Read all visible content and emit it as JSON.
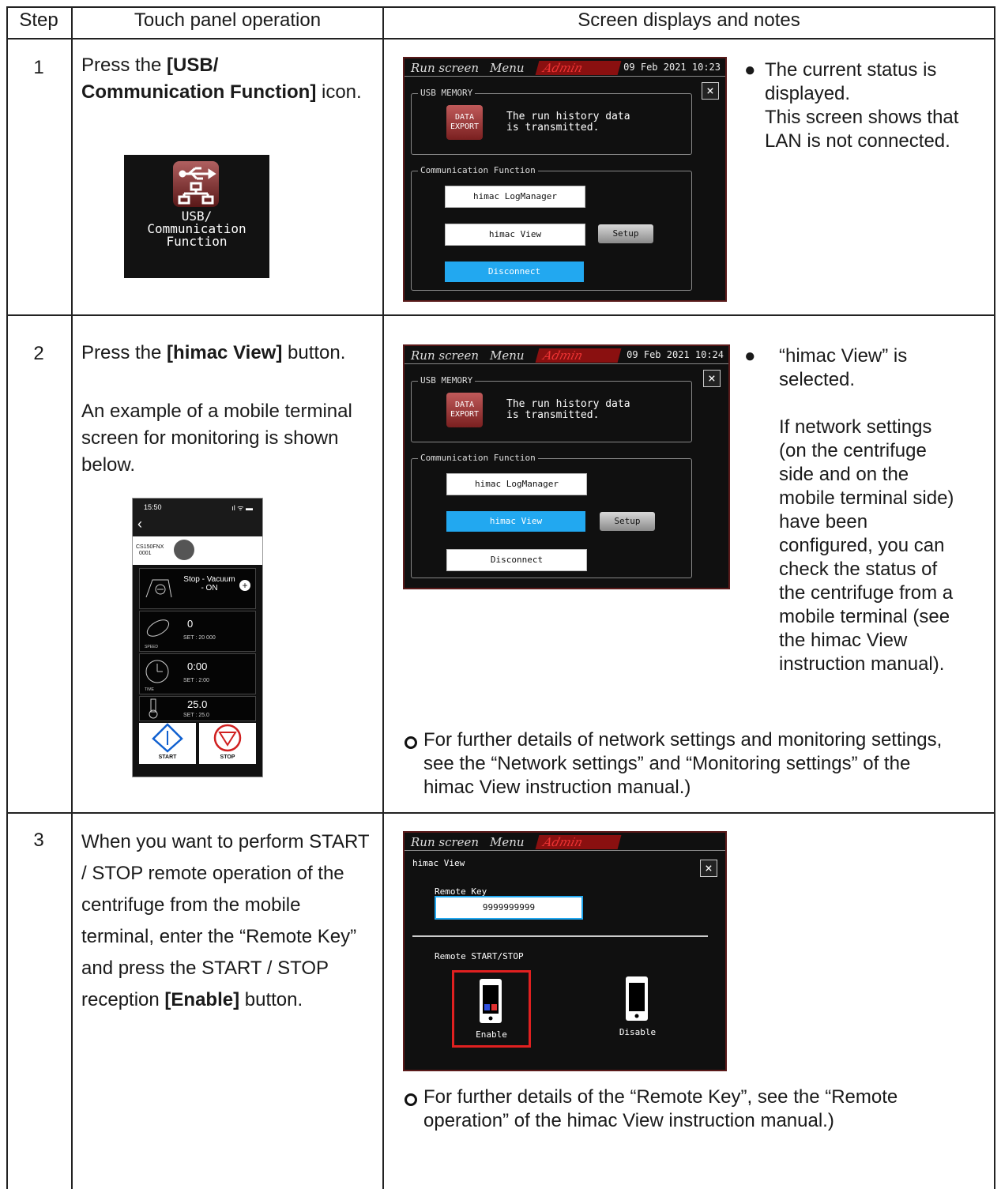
{
  "headers": {
    "step": "Step",
    "operation": "Touch panel operation",
    "notes": "Screen displays and notes"
  },
  "rows": [
    {
      "step": "1",
      "op_pre": "Press the ",
      "op_bold": "[USB/ Communication Function]",
      "op_post": " icon.",
      "icon_label_1": "USB/",
      "icon_label_2": "Communication",
      "icon_label_3": "Function",
      "note_lines": [
        "The current status is",
        "displayed.",
        "This screen shows that",
        "LAN is not connected."
      ]
    },
    {
      "step": "2",
      "op_pre": "Press the ",
      "op_bold": "[himac View]",
      "op_post": " button.",
      "op_extra": "An example of a mobile terminal screen for monitoring is shown below.",
      "note_lines": [
        "“himac View” is",
        "selected.",
        "",
        "If network settings",
        "(on the centrifuge",
        "side and on the",
        "mobile terminal side)",
        "have been",
        "configured, you can",
        "check the status of",
        "the centrifuge from a",
        "mobile terminal (see",
        "the himac View",
        "instruction manual)."
      ],
      "sub_note": "For further details of network settings and monitoring settings, see the “Network settings” and “Monitoring settings” of the himac View instruction manual.)"
    },
    {
      "step": "3",
      "op_text": "When you want to perform START / STOP remote operation of the centrifuge from the mobile terminal, enter the “Remote Key” and press the START / STOP reception ",
      "op_bold": "[Enable]",
      "op_post": " button.",
      "sub_note": "For further details of the “Remote Key”, see the “Remote operation” of the himac View instruction manual.)"
    }
  ],
  "panel": {
    "tab_run": "Run screen",
    "tab_menu": "Menu",
    "tab_admin": "Admin",
    "date1": "09 Feb 2021 10:23",
    "date2": "09 Feb 2021 10:24",
    "close": "×",
    "usb_memory": "USB MEMORY",
    "data_export_1": "DATA",
    "data_export_2": "EXPORT",
    "history_1": "The run history data",
    "history_2": "is transmitted.",
    "comm_func": "Communication Function",
    "logmanager": "himac LogManager",
    "himac_view": "himac View",
    "setup": "Setup",
    "disconnect": "Disconnect",
    "hv_title": "himac View",
    "remote_key_label": "Remote Key",
    "remote_key_value": "9999999999",
    "remote_ss": "Remote START/STOP",
    "enable": "Enable",
    "disable": "Disable"
  },
  "phone": {
    "time": "15:50",
    "signal": "ıl ᯤ ▬",
    "back": "‹",
    "device_1": "CS150FNX",
    "device_2": "0001",
    "status": "Stop - Vacuum",
    "status_2": "- ON",
    "speed": "0",
    "speed_set": "SET : 20 000",
    "speed_lbl": "SPEED",
    "time_val": "0:00",
    "time_set": "SET : 2:00",
    "time_lbl": "TIME",
    "temp": "25.0",
    "temp_set": "SET : 25.0",
    "temp_lbl": "TEMP",
    "start": "START",
    "stop": "STOP"
  },
  "colors": {
    "accent_blue": "#22a8f0",
    "admin_red": "#8a1010",
    "frame_red": "#e02020"
  }
}
